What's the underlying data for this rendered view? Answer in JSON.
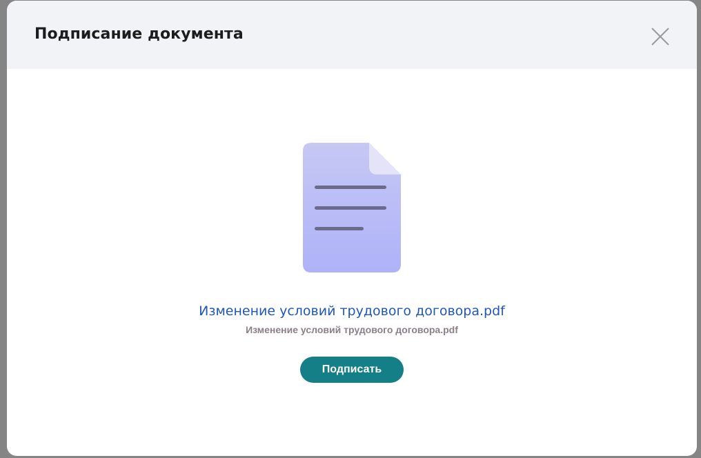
{
  "dialog": {
    "title": "Подписание документа",
    "close_icon": "close-icon"
  },
  "document": {
    "icon": "document-icon",
    "link_text": "Изменение условий трудового договора.pdf",
    "subtitle": "Изменение условий трудового договора.pdf"
  },
  "actions": {
    "sign_label": "Подписать"
  },
  "colors": {
    "header_bg": "#f2f3f7",
    "link": "#1f57b8",
    "subtitle": "#8a7f89",
    "button_bg": "#147f86",
    "icon_fill": "#b7b9f5"
  }
}
